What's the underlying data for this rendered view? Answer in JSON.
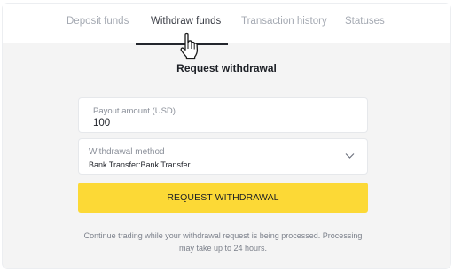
{
  "tabs": [
    {
      "label": "Deposit funds",
      "active": false
    },
    {
      "label": "Withdraw funds",
      "active": true
    },
    {
      "label": "Transaction history",
      "active": false
    },
    {
      "label": "Statuses",
      "active": false
    }
  ],
  "form": {
    "title": "Request withdrawal",
    "payout_amount": {
      "label": "Payout amount (USD)",
      "value": "100"
    },
    "withdrawal_method": {
      "label": "Withdrawal method",
      "value": "Bank Transfer:Bank Transfer",
      "icon": "chevron-down-icon"
    },
    "submit_label": "REQUEST WITHDRAWAL",
    "note": "Continue trading while your withdrawal request is being processed.  Processing may take up to 24 hours."
  },
  "colors": {
    "accent_button": "#fcd936",
    "panel_background": "#f4f4f4",
    "tab_inactive": "#a4a9b2",
    "tab_active": "#3a3d45"
  },
  "cursor": {
    "icon": "hand-pointer-icon"
  }
}
